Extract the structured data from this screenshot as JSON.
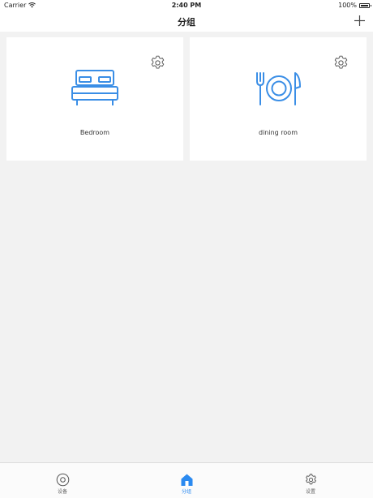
{
  "status_bar": {
    "carrier": "Carrier",
    "time": "2:40 PM",
    "battery": "100%"
  },
  "nav": {
    "title": "分组",
    "add_icon": "plus-icon"
  },
  "groups": [
    {
      "label": "Bedroom",
      "icon": "bed-icon",
      "settings_icon": "gear-icon"
    },
    {
      "label": "dining room",
      "icon": "plate-cutlery-icon",
      "settings_icon": "gear-icon"
    }
  ],
  "tabs": [
    {
      "label": "设备",
      "icon": "device-circle-icon",
      "active": false
    },
    {
      "label": "分组",
      "icon": "home-icon",
      "active": true
    },
    {
      "label": "设置",
      "icon": "gear-icon",
      "active": false
    }
  ],
  "colors": {
    "accent": "#2b8af0",
    "icon_line": "#3a8ee6",
    "background": "#f2f2f2"
  }
}
